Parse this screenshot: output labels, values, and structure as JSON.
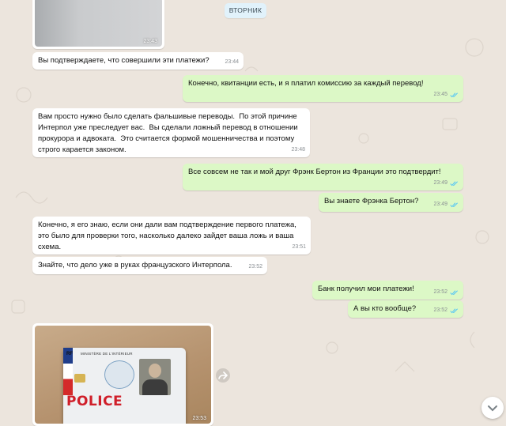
{
  "date_chip": "ВТОРНИК",
  "colors": {
    "background": "#ece5dd",
    "incoming_bubble": "#ffffff",
    "outgoing_bubble": "#dcf8c6",
    "read_ticks": "#4fc3f7",
    "date_chip": "#e1f2fb"
  },
  "top_image": {
    "time": "23:43"
  },
  "messages": [
    {
      "dir": "in",
      "text": "Вы подтверждаете, что совершили эти платежи?",
      "time": "23:44"
    },
    {
      "dir": "out",
      "text": "Конечно, квитанции есть, и я платил комиссию за каждый перевод!",
      "time": "23:45",
      "status": "read"
    },
    {
      "dir": "in",
      "text": "Вам просто нужно было сделать фальшивые переводы.  По этой причине Интерпол уже преследует вас.  Вы сделали ложный перевод в отношении прокурора и адвоката.  Это считается формой мошенничества и поэтому строго карается законом.",
      "time": "23:48"
    },
    {
      "dir": "out",
      "text": "Все совсем не так и мой друг Фрэнк Бертон из Франции это подтвердит!",
      "time": "23:49",
      "status": "read"
    },
    {
      "dir": "out",
      "text": "Вы знаете Фрэнка Бертон?",
      "time": "23:49",
      "status": "read"
    },
    {
      "dir": "in",
      "text": "Конечно, я его знаю, если они дали вам подтверждение первого платежа, это было для проверки того, насколько далеко зайдет ваша ложь и ваша схема.",
      "time": "23:51"
    },
    {
      "dir": "in",
      "text": "Знайте, что дело уже в руках французского Интерпола.",
      "time": "23:52"
    },
    {
      "dir": "out",
      "text": "Банк получил мои платежи!",
      "time": "23:52",
      "status": "read"
    },
    {
      "dir": "out",
      "text": "А вы кто вообще?",
      "time": "23:52",
      "status": "read"
    }
  ],
  "police_image": {
    "time": "23:53",
    "card_header": "MINISTÈRE DE L'INTÉRIEUR",
    "card_word": "POLICE",
    "card_corner": "RF"
  },
  "icons": [
    "forward-icon",
    "chevron-down-icon",
    "double-check-icon"
  ]
}
